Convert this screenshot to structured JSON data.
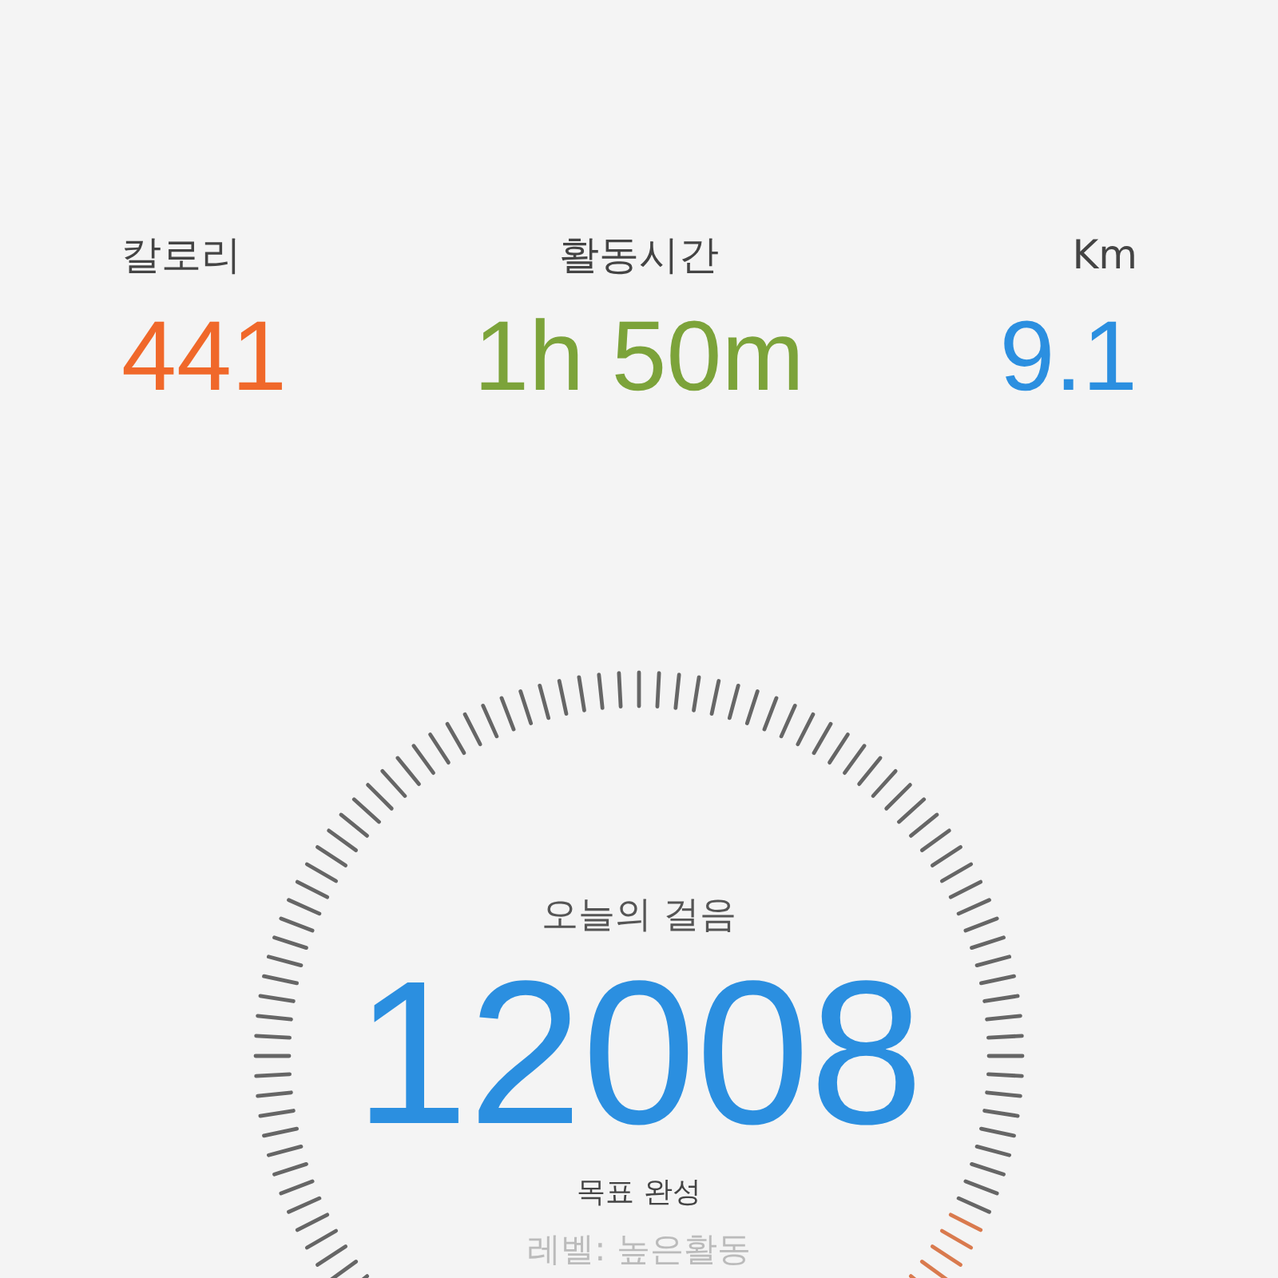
{
  "stats": [
    {
      "label": "칼로리",
      "value": "441",
      "color": "#f0682a"
    },
    {
      "label": "활동시간",
      "value": "1h 50m",
      "color": "#7ca33a"
    },
    {
      "label": "Km",
      "value": "9.1",
      "color": "#2b8fe0"
    }
  ],
  "steps": {
    "title": "오늘의 걸음",
    "count": "12008",
    "status": "목표 완성",
    "level_text": "레벨: 높은활동"
  }
}
